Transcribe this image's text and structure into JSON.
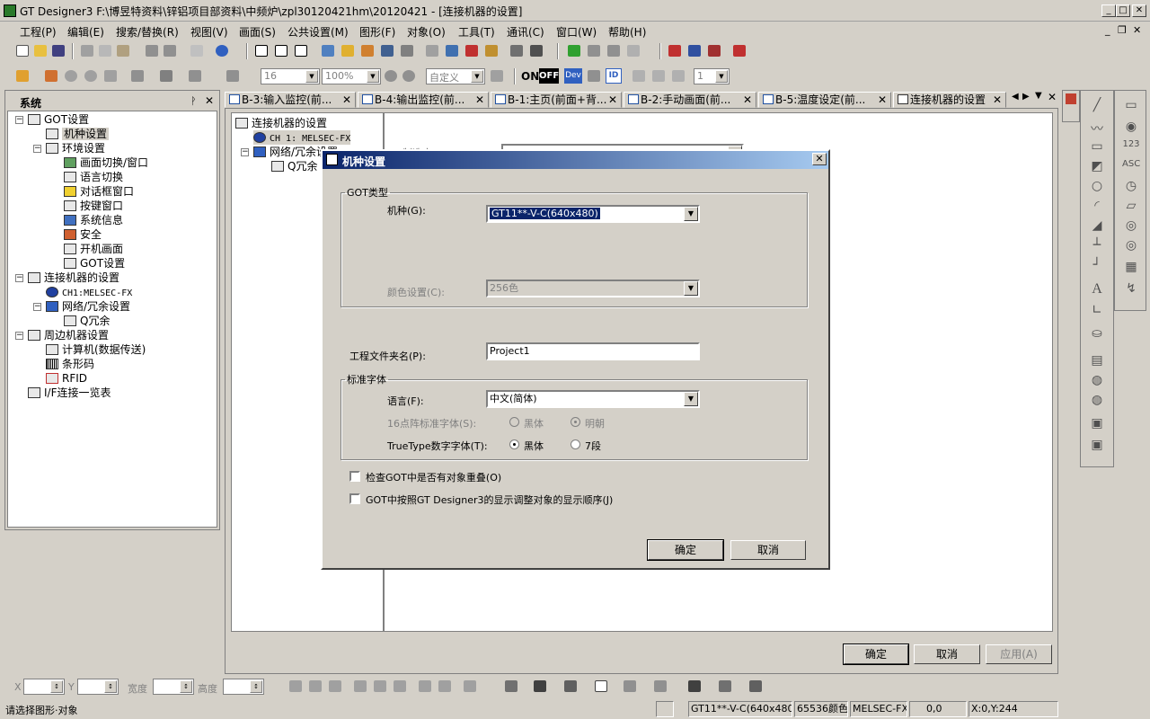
{
  "window": {
    "title": "GT Designer3 F:\\博昱特资料\\锌铝项目部资料\\中频炉\\zpl30120421hm\\20120421 - [连接机器的设置]",
    "minimize": "_",
    "maximize": "□",
    "close": "✕"
  },
  "menu": [
    "工程(P)",
    "编辑(E)",
    "搜索/替换(R)",
    "视图(V)",
    "画面(S)",
    "公共设置(M)",
    "图形(F)",
    "对象(O)",
    "工具(T)",
    "通讯(C)",
    "窗口(W)",
    "帮助(H)"
  ],
  "toolbar2": {
    "font_size": "16",
    "zoom": "100%",
    "custom": "自定义",
    "on_label": "ON",
    "off_label": "OFF",
    "dev_label": "Dev",
    "id_label": "ID",
    "layer": "1"
  },
  "system_panel": {
    "title": "系统",
    "pin": "ᚹ",
    "close": "✕",
    "tree": [
      "GOT设置",
      "机种设置",
      "环境设置",
      "画面切换/窗口",
      "语言切换",
      "对话框窗口",
      "按键窗口",
      "系统信息",
      "安全",
      "开机画面",
      "GOT设置",
      "连接机器的设置",
      "CH1:MELSEC-FX",
      "网络/冗余设置",
      "Q冗余",
      "周边机器设置",
      "计算机(数据传送)",
      "条形码",
      "RFID",
      "I/F连接一览表"
    ]
  },
  "tabs": [
    "B-3:输入监控(前...",
    "B-4:输出监控(前...",
    "B-1:主页(前面+背...",
    "B-2:手动画面(前...",
    "B-5:温度设定(前...",
    "连接机器的设置"
  ],
  "doc": {
    "tree": [
      "连接机器的设置",
      "CH 1: MELSEC-FX",
      "网络/冗余设置",
      "Q冗余"
    ],
    "maker_label": "制造商(M)",
    "ok": "确定",
    "cancel": "取消",
    "apply": "应用(A)"
  },
  "dialog": {
    "title": "机种设置",
    "got_type_group": "GOT类型",
    "model_label": "机种(G):",
    "model_value": "GT11**-V-C(640x480)",
    "color_label": "颜色设置(C):",
    "color_value": "256色",
    "project_folder_label": "工程文件夹名(P):",
    "project_folder_value": "Project1",
    "font_group": "标准字体",
    "language_label": "语言(F):",
    "language_value": "中文(简体)",
    "font16_label": "16点阵标准字体(S):",
    "font16_opt1": "黑体",
    "font16_opt2": "明朝",
    "truetype_label": "TrueType数字字体(T):",
    "truetype_opt1": "黑体",
    "truetype_opt2": "7段",
    "check1": "检查GOT中是否有对象重叠(O)",
    "check2": "GOT中按照GT Designer3的显示调整对象的显示顺序(J)",
    "ok": "确定",
    "cancel": "取消"
  },
  "bottom_toolbar": {
    "x_label": "X",
    "y_label": "Y",
    "width_label": "宽度",
    "height_label": "高度"
  },
  "status": {
    "message": "请选择图形·对象",
    "model": "GT11**-V-C(640x480)",
    "colors": "65536颜色",
    "controller": "MELSEC-FX",
    "pos": "0,0",
    "xy": "X:0,Y:244"
  }
}
